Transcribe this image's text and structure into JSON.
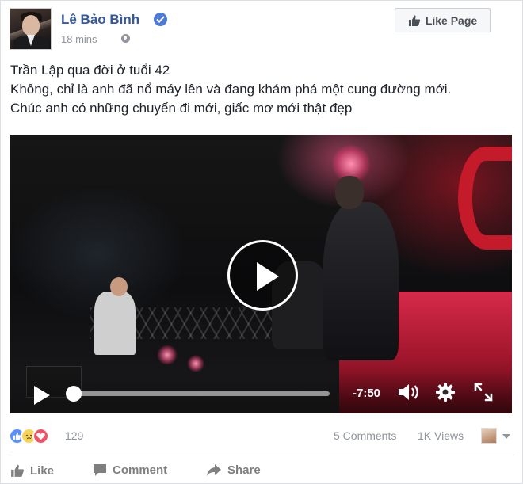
{
  "post": {
    "author": "Lê Bảo Bình",
    "timestamp": "18 mins",
    "privacy_icon": "globe-icon",
    "verified_icon": "verified-badge-icon",
    "like_page_label": "Like Page",
    "text_lines": [
      "Trần Lập qua đời ở tuổi 42",
      "Không, chỉ là anh đã nổ máy lên và đang khám phá một cung đường mới.",
      "Chúc anh có những chuyến đi mới, giấc mơ mới thật đẹp"
    ]
  },
  "video": {
    "remaining_time": "-7:50",
    "progress_fraction": 0.0,
    "controls": [
      "play-icon",
      "volume-icon",
      "settings-icon",
      "fullscreen-icon"
    ]
  },
  "stats": {
    "reactions": [
      "like",
      "sad",
      "love"
    ],
    "reaction_count": "129",
    "comments": "5 Comments",
    "views": "1K Views"
  },
  "actions": {
    "like": "Like",
    "comment": "Comment",
    "share": "Share"
  },
  "colors": {
    "link_blue": "#365899",
    "muted_gray": "#90949c",
    "like_reaction": "#5890ff",
    "love_reaction": "#f25268",
    "sad_reaction": "#f7d358"
  }
}
